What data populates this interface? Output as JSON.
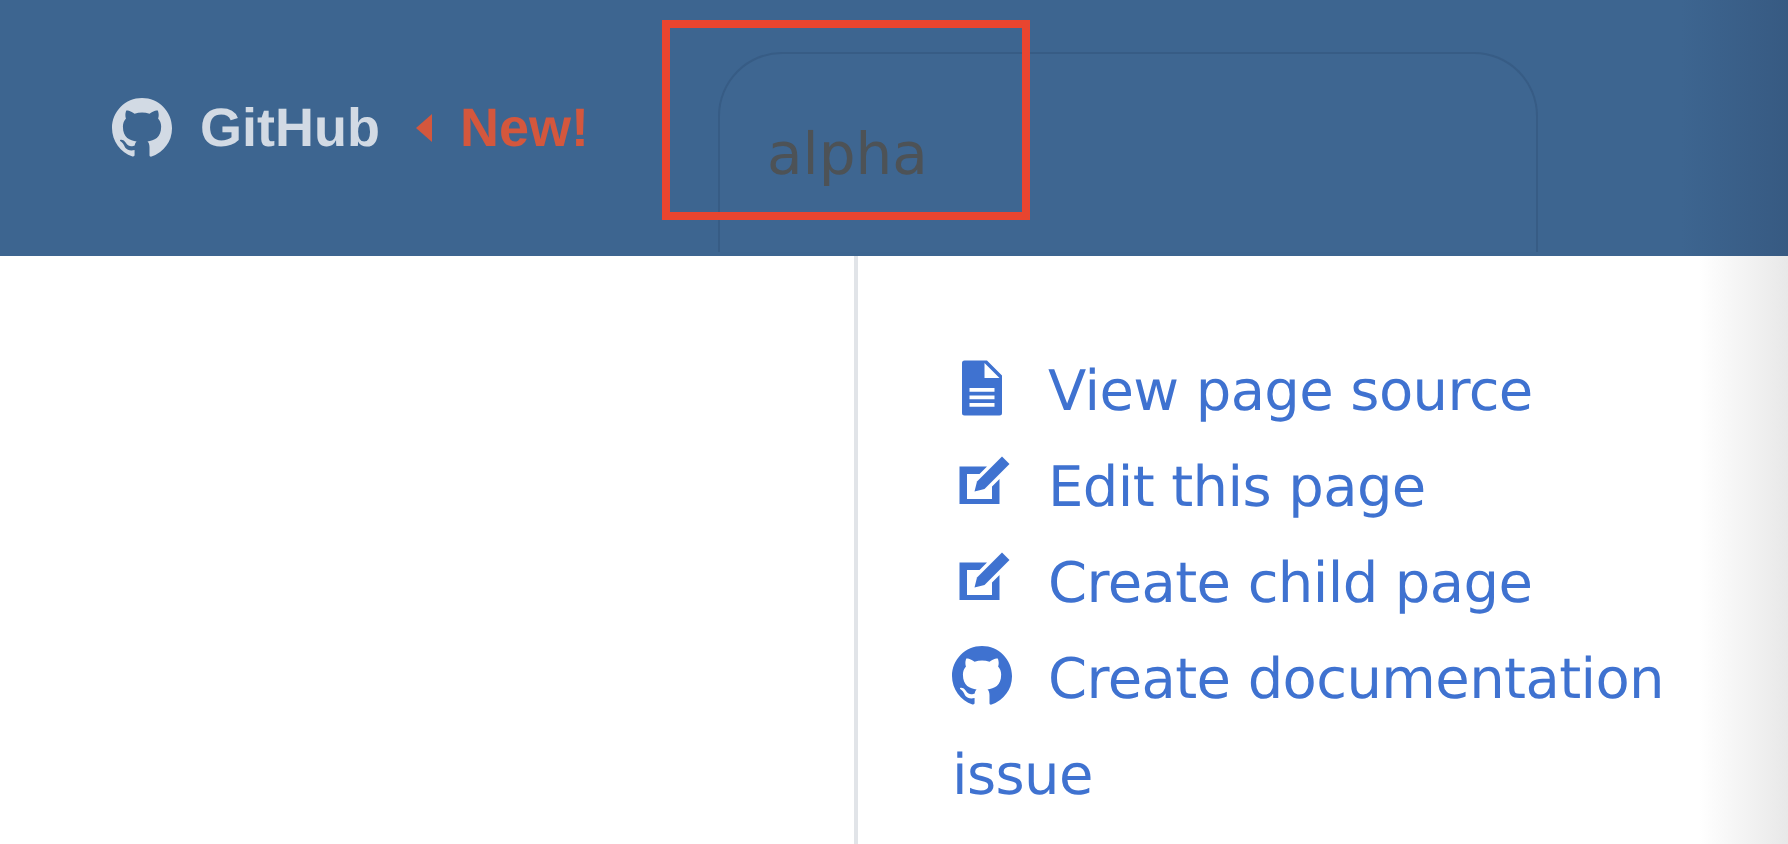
{
  "header": {
    "brand": "GitHub",
    "badge": "New!",
    "search": {
      "value": "alpha",
      "highlighted": true
    }
  },
  "links": [
    {
      "kind": "file",
      "label": "View page source"
    },
    {
      "kind": "edit",
      "label": "Edit this page"
    },
    {
      "kind": "edit",
      "label": "Create child page"
    },
    {
      "kind": "github",
      "label": "Create documentation issue"
    }
  ]
}
